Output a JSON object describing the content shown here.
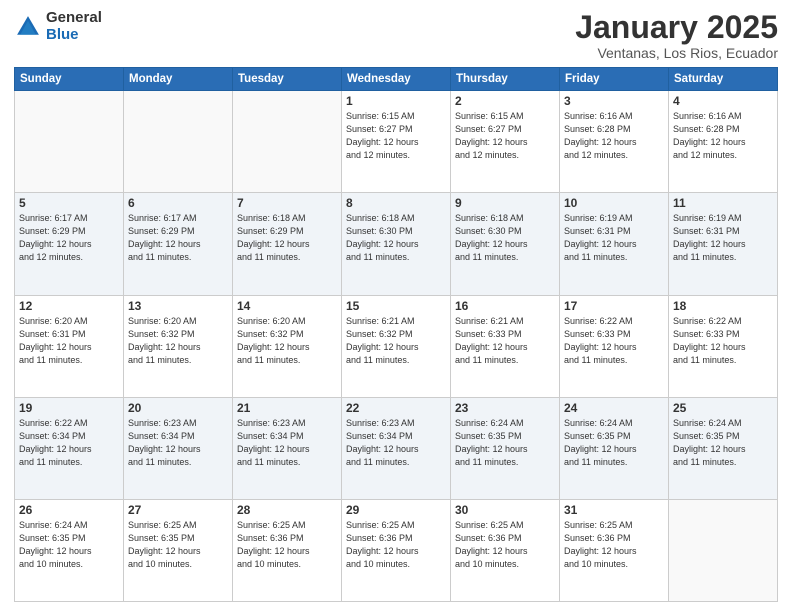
{
  "logo": {
    "general": "General",
    "blue": "Blue"
  },
  "header": {
    "title": "January 2025",
    "subtitle": "Ventanas, Los Rios, Ecuador"
  },
  "days_of_week": [
    "Sunday",
    "Monday",
    "Tuesday",
    "Wednesday",
    "Thursday",
    "Friday",
    "Saturday"
  ],
  "weeks": [
    [
      {
        "day": "",
        "info": ""
      },
      {
        "day": "",
        "info": ""
      },
      {
        "day": "",
        "info": ""
      },
      {
        "day": "1",
        "info": "Sunrise: 6:15 AM\nSunset: 6:27 PM\nDaylight: 12 hours\nand 12 minutes."
      },
      {
        "day": "2",
        "info": "Sunrise: 6:15 AM\nSunset: 6:27 PM\nDaylight: 12 hours\nand 12 minutes."
      },
      {
        "day": "3",
        "info": "Sunrise: 6:16 AM\nSunset: 6:28 PM\nDaylight: 12 hours\nand 12 minutes."
      },
      {
        "day": "4",
        "info": "Sunrise: 6:16 AM\nSunset: 6:28 PM\nDaylight: 12 hours\nand 12 minutes."
      }
    ],
    [
      {
        "day": "5",
        "info": "Sunrise: 6:17 AM\nSunset: 6:29 PM\nDaylight: 12 hours\nand 12 minutes."
      },
      {
        "day": "6",
        "info": "Sunrise: 6:17 AM\nSunset: 6:29 PM\nDaylight: 12 hours\nand 11 minutes."
      },
      {
        "day": "7",
        "info": "Sunrise: 6:18 AM\nSunset: 6:29 PM\nDaylight: 12 hours\nand 11 minutes."
      },
      {
        "day": "8",
        "info": "Sunrise: 6:18 AM\nSunset: 6:30 PM\nDaylight: 12 hours\nand 11 minutes."
      },
      {
        "day": "9",
        "info": "Sunrise: 6:18 AM\nSunset: 6:30 PM\nDaylight: 12 hours\nand 11 minutes."
      },
      {
        "day": "10",
        "info": "Sunrise: 6:19 AM\nSunset: 6:31 PM\nDaylight: 12 hours\nand 11 minutes."
      },
      {
        "day": "11",
        "info": "Sunrise: 6:19 AM\nSunset: 6:31 PM\nDaylight: 12 hours\nand 11 minutes."
      }
    ],
    [
      {
        "day": "12",
        "info": "Sunrise: 6:20 AM\nSunset: 6:31 PM\nDaylight: 12 hours\nand 11 minutes."
      },
      {
        "day": "13",
        "info": "Sunrise: 6:20 AM\nSunset: 6:32 PM\nDaylight: 12 hours\nand 11 minutes."
      },
      {
        "day": "14",
        "info": "Sunrise: 6:20 AM\nSunset: 6:32 PM\nDaylight: 12 hours\nand 11 minutes."
      },
      {
        "day": "15",
        "info": "Sunrise: 6:21 AM\nSunset: 6:32 PM\nDaylight: 12 hours\nand 11 minutes."
      },
      {
        "day": "16",
        "info": "Sunrise: 6:21 AM\nSunset: 6:33 PM\nDaylight: 12 hours\nand 11 minutes."
      },
      {
        "day": "17",
        "info": "Sunrise: 6:22 AM\nSunset: 6:33 PM\nDaylight: 12 hours\nand 11 minutes."
      },
      {
        "day": "18",
        "info": "Sunrise: 6:22 AM\nSunset: 6:33 PM\nDaylight: 12 hours\nand 11 minutes."
      }
    ],
    [
      {
        "day": "19",
        "info": "Sunrise: 6:22 AM\nSunset: 6:34 PM\nDaylight: 12 hours\nand 11 minutes."
      },
      {
        "day": "20",
        "info": "Sunrise: 6:23 AM\nSunset: 6:34 PM\nDaylight: 12 hours\nand 11 minutes."
      },
      {
        "day": "21",
        "info": "Sunrise: 6:23 AM\nSunset: 6:34 PM\nDaylight: 12 hours\nand 11 minutes."
      },
      {
        "day": "22",
        "info": "Sunrise: 6:23 AM\nSunset: 6:34 PM\nDaylight: 12 hours\nand 11 minutes."
      },
      {
        "day": "23",
        "info": "Sunrise: 6:24 AM\nSunset: 6:35 PM\nDaylight: 12 hours\nand 11 minutes."
      },
      {
        "day": "24",
        "info": "Sunrise: 6:24 AM\nSunset: 6:35 PM\nDaylight: 12 hours\nand 11 minutes."
      },
      {
        "day": "25",
        "info": "Sunrise: 6:24 AM\nSunset: 6:35 PM\nDaylight: 12 hours\nand 11 minutes."
      }
    ],
    [
      {
        "day": "26",
        "info": "Sunrise: 6:24 AM\nSunset: 6:35 PM\nDaylight: 12 hours\nand 10 minutes."
      },
      {
        "day": "27",
        "info": "Sunrise: 6:25 AM\nSunset: 6:35 PM\nDaylight: 12 hours\nand 10 minutes."
      },
      {
        "day": "28",
        "info": "Sunrise: 6:25 AM\nSunset: 6:36 PM\nDaylight: 12 hours\nand 10 minutes."
      },
      {
        "day": "29",
        "info": "Sunrise: 6:25 AM\nSunset: 6:36 PM\nDaylight: 12 hours\nand 10 minutes."
      },
      {
        "day": "30",
        "info": "Sunrise: 6:25 AM\nSunset: 6:36 PM\nDaylight: 12 hours\nand 10 minutes."
      },
      {
        "day": "31",
        "info": "Sunrise: 6:25 AM\nSunset: 6:36 PM\nDaylight: 12 hours\nand 10 minutes."
      },
      {
        "day": "",
        "info": ""
      }
    ]
  ]
}
